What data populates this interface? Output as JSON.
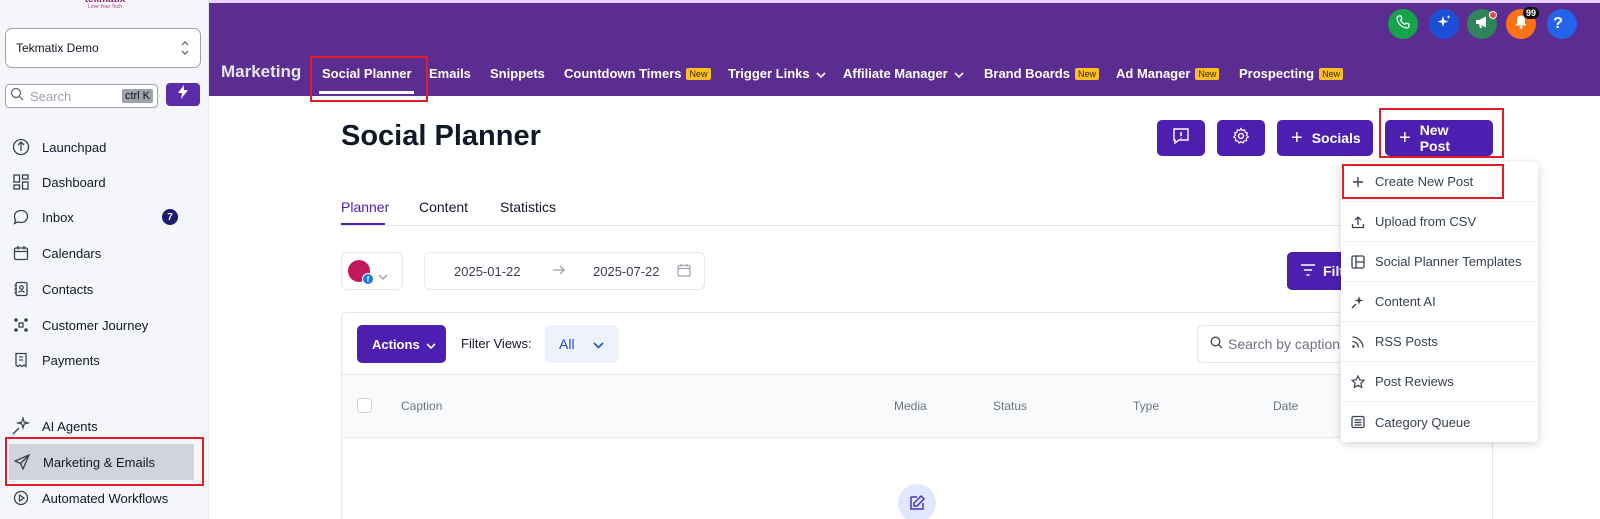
{
  "brand": {
    "name": "tekmatix",
    "tagline": "Love Your Tech"
  },
  "account": {
    "name": "Tekmatix Demo"
  },
  "search": {
    "placeholder": "Search",
    "shortcut": "ctrl K"
  },
  "sidebar": {
    "items": [
      {
        "label": "Launchpad",
        "icon": "rocket-icon"
      },
      {
        "label": "Dashboard",
        "icon": "dashboard-icon"
      },
      {
        "label": "Inbox",
        "icon": "chat-icon",
        "badge": "7"
      },
      {
        "label": "Calendars",
        "icon": "calendar-icon"
      },
      {
        "label": "Contacts",
        "icon": "contacts-icon"
      },
      {
        "label": "Customer Journey",
        "icon": "journey-icon"
      },
      {
        "label": "Payments",
        "icon": "payments-icon"
      },
      {
        "label": "AI Agents",
        "icon": "sparkle-icon"
      },
      {
        "label": "Marketing & Emails",
        "icon": "send-icon",
        "active": true
      },
      {
        "label": "Automated Workflows",
        "icon": "workflow-icon"
      }
    ]
  },
  "topbar": {
    "section": "Marketing",
    "tabs": [
      {
        "label": "Social Planner",
        "active": true
      },
      {
        "label": "Emails"
      },
      {
        "label": "Snippets"
      },
      {
        "label": "Countdown Timers",
        "new": "New"
      },
      {
        "label": "Trigger Links",
        "dropdown": true
      },
      {
        "label": "Affiliate Manager",
        "dropdown": true
      },
      {
        "label": "Brand Boards",
        "new": "New"
      },
      {
        "label": "Ad Manager",
        "new": "New"
      },
      {
        "label": "Prospecting",
        "new": "New"
      }
    ],
    "notifications_count": "99",
    "colors": {
      "bar": "#5b2d91",
      "phone": "#16a34a",
      "ai": "#1d4ed8",
      "megaphone": "#2f855a",
      "bell": "#f97316",
      "help": "#2563eb"
    }
  },
  "page": {
    "title": "Social Planner",
    "buttons": {
      "socials": "Socials",
      "new_post": "New Post"
    },
    "subtabs": [
      "Planner",
      "Content",
      "Statistics"
    ],
    "date_range": {
      "start": "2025-01-22",
      "end": "2025-07-22"
    },
    "filter_label": "Filt"
  },
  "table": {
    "actions_label": "Actions",
    "filter_views_label": "Filter Views:",
    "filter_views_value": "All",
    "search_placeholder": "Search by caption",
    "columns": [
      "Caption",
      "Media",
      "Status",
      "Type",
      "Date"
    ]
  },
  "dropdown": {
    "items": [
      {
        "label": "Create New Post",
        "icon": "plus-icon"
      },
      {
        "label": "Upload from CSV",
        "icon": "upload-icon"
      },
      {
        "label": "Social Planner Templates",
        "icon": "template-icon"
      },
      {
        "label": "Content AI",
        "icon": "ai-sparkle-icon"
      },
      {
        "label": "RSS Posts",
        "icon": "rss-icon"
      },
      {
        "label": "Post Reviews",
        "icon": "star-icon"
      },
      {
        "label": "Category Queue",
        "icon": "queue-icon"
      }
    ]
  },
  "accent": "#4c1fb0"
}
